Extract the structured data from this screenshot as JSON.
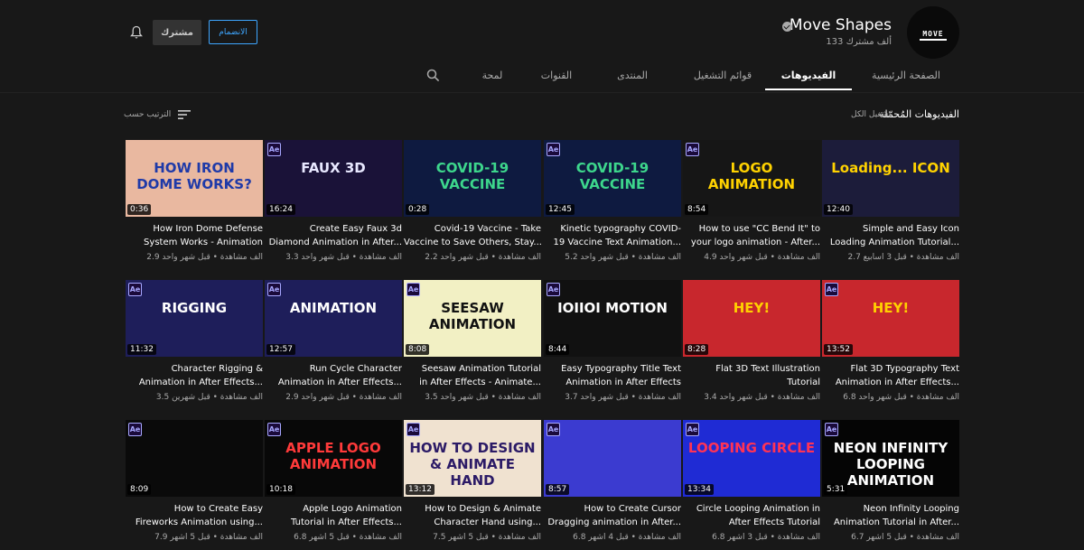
{
  "channel": {
    "name": "Move Shapes",
    "subscribers": "133 ألف مشترك",
    "avatar_text": "MOVE",
    "join_label": "الانضمام",
    "subscribed_label": "مشترك"
  },
  "tabs": [
    {
      "label": "الصفحة الرئيسية"
    },
    {
      "label": "الفيديوهات"
    },
    {
      "label": "قوائم التشغيل"
    },
    {
      "label": "المنتدى"
    },
    {
      "label": "القنوات"
    },
    {
      "label": "لمحة"
    }
  ],
  "section": {
    "title": "الفيديوهات المُحمّلة",
    "play_all": "تشغيل الكل",
    "sort_label": "الترتيب حسب"
  },
  "videos": [
    {
      "title1": "Simple and Easy Icon",
      "title2": "Loading Animation Tutorial...",
      "meta": "2.7 ألف مشاهدة • قبل 3 أسابيع",
      "duration": "12:40",
      "thumb_text": "Loading... ICON",
      "bg": "#1c1c3a",
      "fg": "#ffd200",
      "ae": false
    },
    {
      "title1": "How to use \"CC Bend It\" to",
      "title2": "your logo animation - After...",
      "meta": "4.9 ألف مشاهدة • قبل شهر واحد",
      "duration": "8:54",
      "thumb_text": "LOGO ANIMATION",
      "bg": "#161616",
      "fg": "#ffd200",
      "ae": true
    },
    {
      "title1": "Kinetic typography COVID-",
      "title2": "19 Vaccine Text Animation...",
      "meta": "5.2 ألف مشاهدة • قبل شهر واحد",
      "duration": "12:45",
      "thumb_text": "COVID-19 VACCINE",
      "bg": "#0e1a40",
      "fg": "#3dd68c",
      "ae": true
    },
    {
      "title1": "Covid-19 Vaccine - Take",
      "title2": "Vaccine to Save Others, Stay...",
      "meta": "2.2 ألف مشاهدة • قبل شهر واحد",
      "duration": "0:28",
      "thumb_text": "COVID-19 VACCINE",
      "bg": "#0e1a40",
      "fg": "#3dd68c",
      "ae": false
    },
    {
      "title1": "Create Easy Faux 3d",
      "title2": "Diamond Animation in After...",
      "meta": "3.3 ألف مشاهدة • قبل شهر واحد",
      "duration": "16:24",
      "thumb_text": "FAUX 3D",
      "bg": "#1a1238",
      "fg": "#e8e8ff",
      "ae": true
    },
    {
      "title1": "How Iron Dome Defense",
      "title2": "System Works - Animation",
      "meta": "2.9 ألف مشاهدة • قبل شهر واحد",
      "duration": "0:36",
      "thumb_text": "HOW IRON DOME WORKS?",
      "bg": "#e9b8a0",
      "fg": "#1f3aa8",
      "ae": false
    },
    {
      "title1": "Flat 3D Typography Text",
      "title2": "Animation in After Effects...",
      "meta": "6.8 ألف مشاهدة • قبل شهر واحد",
      "duration": "13:52",
      "thumb_text": "HEY!",
      "bg": "#c8272d",
      "fg": "#ffd000",
      "ae": true
    },
    {
      "title1": "Flat 3D Text Illustration",
      "title2": "Tutorial",
      "meta": "3.4 ألف مشاهدة • قبل شهر واحد",
      "duration": "8:28",
      "thumb_text": "HEY!",
      "bg": "#c8272d",
      "fg": "#ffd000",
      "ae": false
    },
    {
      "title1": "Easy Typography Title Text",
      "title2": "Animation in After Effects",
      "meta": "3.7 ألف مشاهدة • قبل شهر واحد",
      "duration": "8:44",
      "thumb_text": "IOIIOI MOTION",
      "bg": "#111111",
      "fg": "#ffffff",
      "ae": true
    },
    {
      "title1": "Seesaw Animation Tutorial",
      "title2": "in After Effects - Animate...",
      "meta": "3.5 ألف مشاهدة • قبل شهر واحد",
      "duration": "8:08",
      "thumb_text": "SEESAW ANIMATION",
      "bg": "#f2f0c4",
      "fg": "#111111",
      "ae": true
    },
    {
      "title1": "Run Cycle Character",
      "title2": "Animation in After Effects...",
      "meta": "2.9 ألف مشاهدة • قبل شهر واحد",
      "duration": "12:57",
      "thumb_text": "ANIMATION",
      "bg": "#1e1e5a",
      "fg": "#ffffff",
      "ae": true
    },
    {
      "title1": "Character Rigging &",
      "title2": "Animation in After Effects...",
      "meta": "3.5 ألف مشاهدة • قبل شهرين",
      "duration": "11:32",
      "thumb_text": "RIGGING",
      "bg": "#1e1e5a",
      "fg": "#ffffff",
      "ae": true
    },
    {
      "title1": "Neon Infinity Looping",
      "title2": "Animation Tutorial in After...",
      "meta": "6.7 ألف مشاهدة • قبل 5 أشهر",
      "duration": "5:31",
      "thumb_text": "NEON INFINITY LOOPING ANIMATION",
      "bg": "#050505",
      "fg": "#ffffff",
      "ae": true
    },
    {
      "title1": "Circle Looping Animation in",
      "title2": "After Effects Tutorial",
      "meta": "6.8 ألف مشاهدة • قبل 3 أشهر",
      "duration": "13:34",
      "thumb_text": "LOOPING CIRCLE",
      "bg": "#1f2bd4",
      "fg": "#ff3355",
      "ae": true
    },
    {
      "title1": "How to Create Cursor",
      "title2": "Dragging animation in After...",
      "meta": "6.8 ألف مشاهدة • قبل 4 أشهر",
      "duration": "8:57",
      "thumb_text": "",
      "bg": "#3b3bd0",
      "fg": "#ffffff",
      "ae": true
    },
    {
      "title1": "How to Design & Animate",
      "title2": "Character Hand using...",
      "meta": "7.5 ألف مشاهدة • قبل 5 أشهر",
      "duration": "13:12",
      "thumb_text": "HOW TO DESIGN & ANIMATE HAND",
      "bg": "#f0e2d0",
      "fg": "#2b1a66",
      "ae": true
    },
    {
      "title1": "Apple Logo Animation",
      "title2": "Tutorial in After Effects...",
      "meta": "6.8 ألف مشاهدة • قبل 5 أشهر",
      "duration": "10:18",
      "thumb_text": "APPLE LOGO ANIMATION",
      "bg": "#080808",
      "fg": "#ff3a3a",
      "ae": true
    },
    {
      "title1": "How to Create Easy",
      "title2": "Fireworks Animation using...",
      "meta": "7.9 ألف مشاهدة • قبل 5 أشهر",
      "duration": "8:09",
      "thumb_text": "",
      "bg": "#0a0a0a",
      "fg": "#ff4a4a",
      "ae": true
    }
  ]
}
